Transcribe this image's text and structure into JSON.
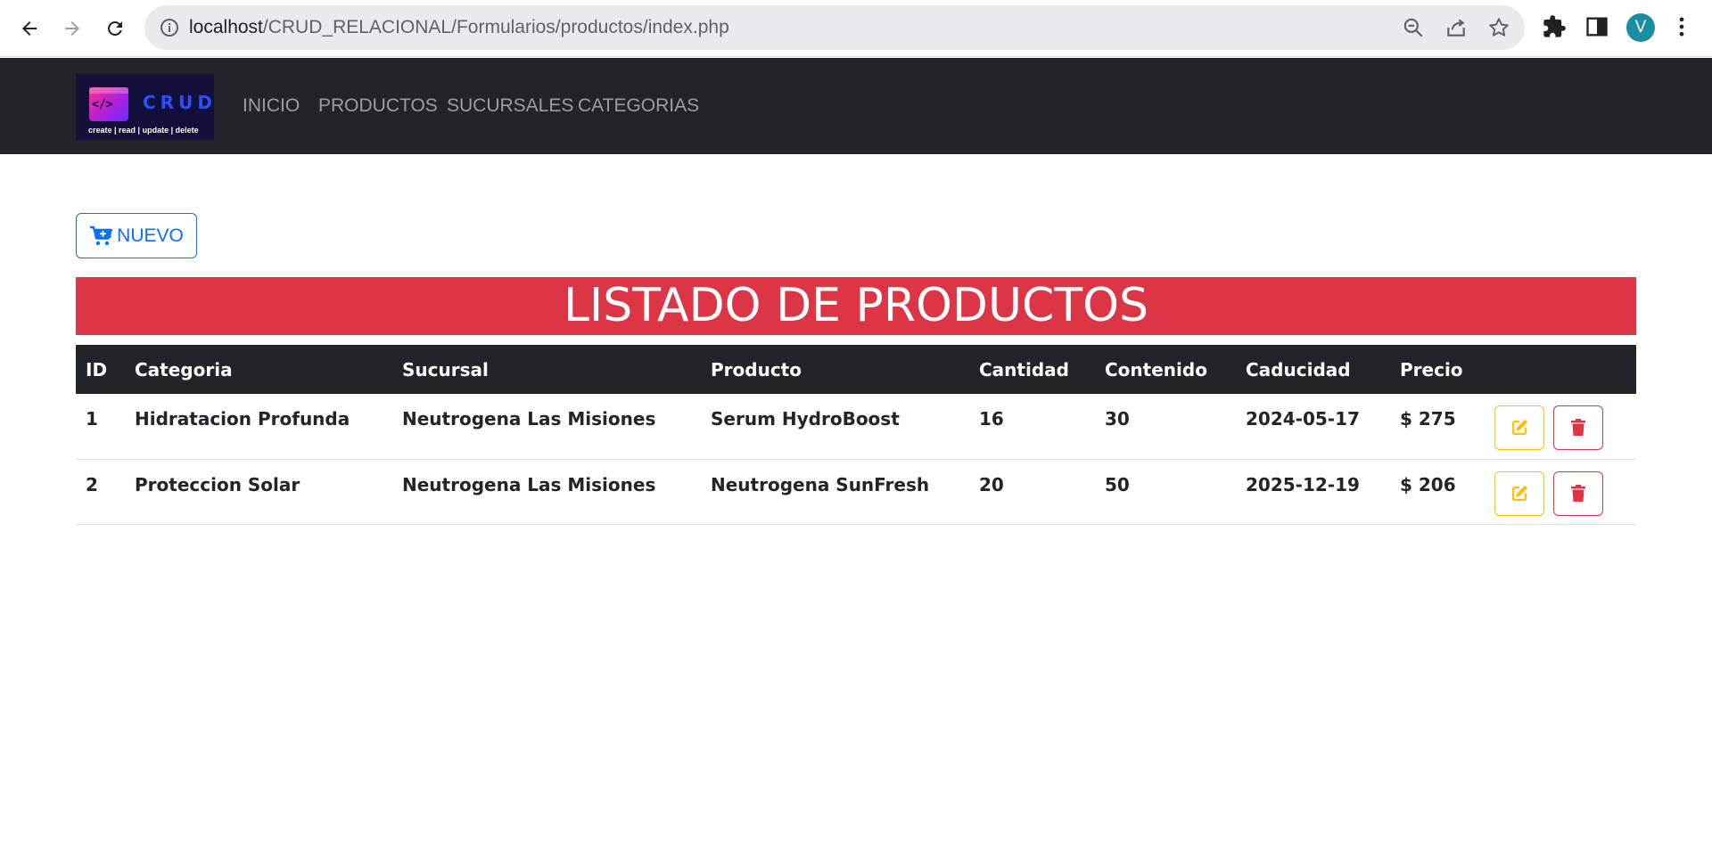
{
  "browser": {
    "url_host": "localhost",
    "url_path": "/CRUD_RELACIONAL/Formularios/productos/index.php",
    "profile_initial": "V"
  },
  "nav": {
    "logo_word": "CRUD",
    "logo_tagline": "create | read | update | delete",
    "logo_code": "</>",
    "links": [
      "INICIO",
      "PRODUCTOS",
      "SUCURSALES",
      "CATEGORIAS"
    ]
  },
  "new_button_label": "NUEVO",
  "title": "LISTADO DE PRODUCTOS",
  "table": {
    "headers": [
      "ID",
      "Categoria",
      "Sucursal",
      "Producto",
      "Cantidad",
      "Contenido",
      "Caducidad",
      "Precio"
    ],
    "rows": [
      [
        "1",
        "Hidratacion Profunda",
        "Neutrogena Las Misiones",
        "Serum HydroBoost",
        "16",
        "30",
        "2024-05-17",
        "$ 275"
      ],
      [
        "2",
        "Proteccion Solar",
        "Neutrogena Las Misiones",
        "Neutrogena SunFresh",
        "20",
        "50",
        "2025-12-19",
        "$ 206"
      ]
    ]
  },
  "colors": {
    "navbar": "#212529",
    "banner": "#dc3545",
    "primary": "#0d6efd",
    "warning": "#ffc107",
    "danger": "#dc3545"
  },
  "icons": [
    "back-arrow-icon",
    "forward-arrow-icon",
    "reload-icon",
    "info-icon",
    "zoom-out-icon",
    "share-icon",
    "bookmark-star-icon",
    "extensions-puzzle-icon",
    "side-panel-icon",
    "menu-kebab-icon",
    "cart-plus-icon",
    "edit-icon",
    "trash-icon"
  ]
}
